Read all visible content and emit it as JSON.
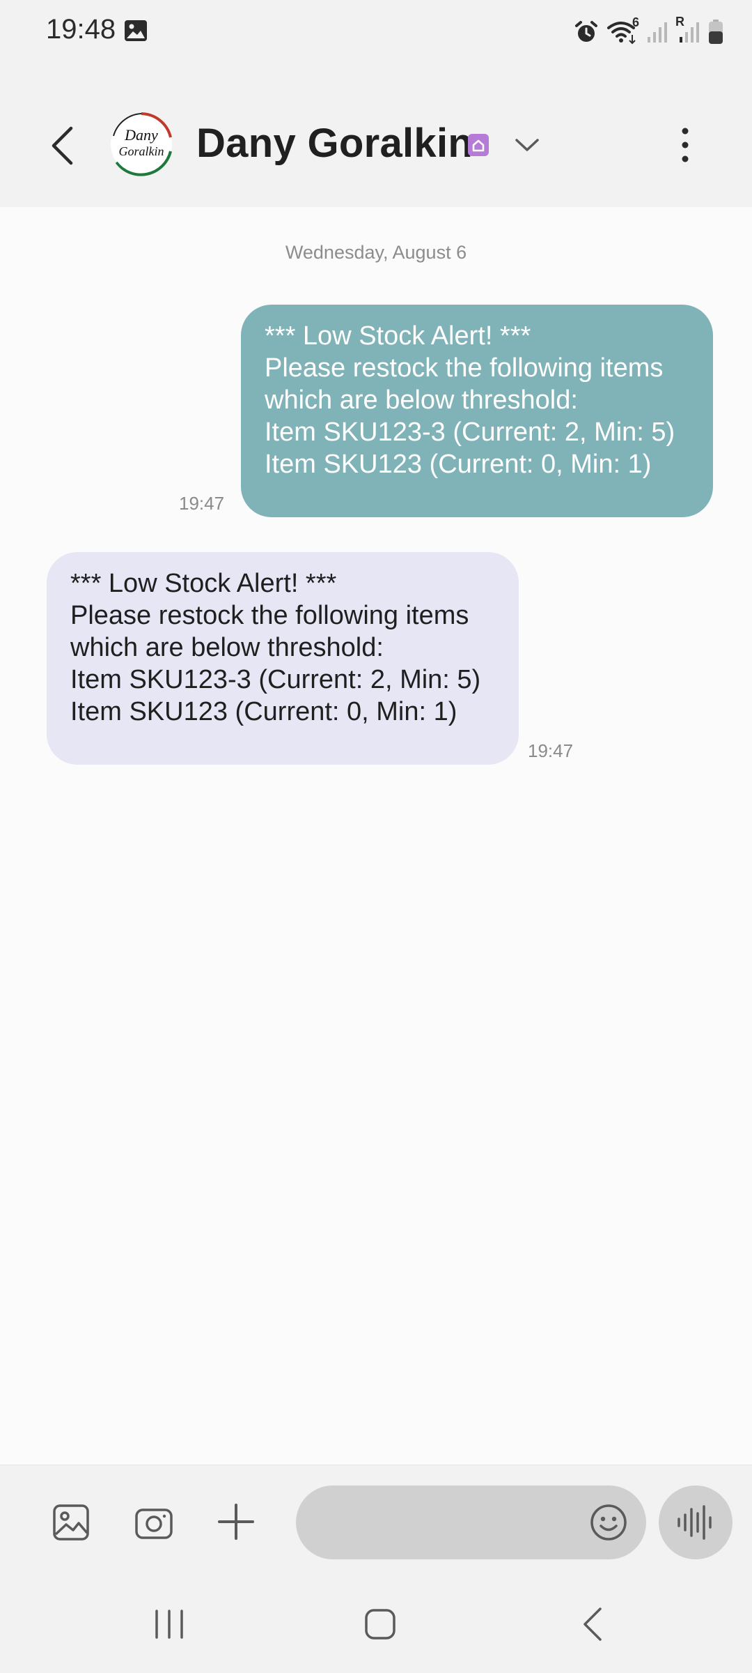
{
  "status_bar": {
    "time": "19:48",
    "icons": [
      "gallery-notification-icon",
      "alarm-icon",
      "wifi-icon",
      "signal-icon",
      "roaming-signal-icon",
      "battery-icon"
    ],
    "wifi_badge": "6",
    "roaming_badge": "R"
  },
  "header": {
    "contact_name": "Dany Goralkin",
    "avatar_text_line1": "Dany",
    "avatar_text_line2": "Goralkin",
    "icons": [
      "back-arrow-icon",
      "home-badge-icon",
      "chevron-down-icon",
      "more-vert-icon"
    ]
  },
  "conversation": {
    "date_separator": "Wednesday, August 6",
    "messages": [
      {
        "direction": "sent",
        "text": "*** Low Stock Alert! ***\nPlease restock the following items which are below threshold:\nItem SKU123-3 (Current: 2, Min: 5)\nItem SKU123 (Current: 0, Min: 1)",
        "time": "19:47"
      },
      {
        "direction": "received",
        "text": "*** Low Stock Alert! ***\nPlease restock the following items which are below threshold:\nItem SKU123-3 (Current: 2, Min: 5)\nItem SKU123 (Current: 0, Min: 1)",
        "time": "19:47"
      }
    ]
  },
  "composer": {
    "message_value": "",
    "message_placeholder": "",
    "icons": [
      "gallery-icon",
      "camera-icon",
      "plus-icon",
      "emoji-icon",
      "voice-waveform-icon"
    ]
  },
  "nav_bar": {
    "icons": [
      "recent-apps-icon",
      "home-icon",
      "back-icon"
    ]
  },
  "colors": {
    "sent_bubble": "#7fb3b7",
    "received_bubble": "#e7e6f5",
    "chrome_background": "#f2f2f2",
    "home_badge": "#b57bd6"
  }
}
